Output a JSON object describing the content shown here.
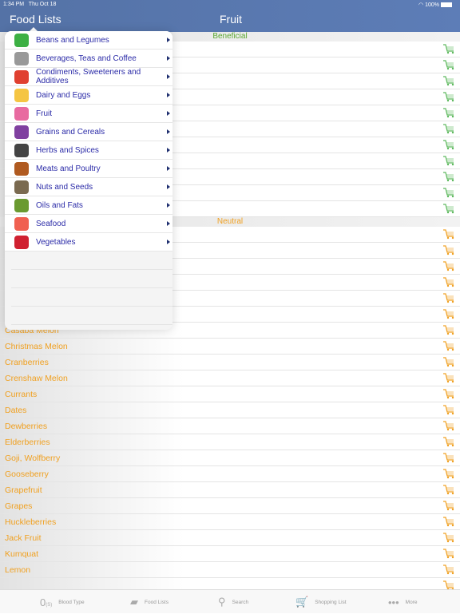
{
  "status": {
    "time": "1:34 PM",
    "date": "Thu Oct 18",
    "battery": "100%"
  },
  "nav": {
    "back": "Food Lists",
    "title": "Fruit"
  },
  "colors": {
    "beneficial": "#5aa830",
    "neutral": "#f0a020",
    "nav": "#5a7ab0",
    "menu_text": "#2c2ca8"
  },
  "sections": [
    {
      "label": "Beneficial",
      "color": "#5aa830",
      "items": [
        "",
        "",
        "",
        "",
        "",
        "",
        "",
        "",
        "",
        "",
        ""
      ]
    },
    {
      "label": "Neutral",
      "color": "#f0a020",
      "items": [
        "",
        "",
        "",
        "",
        "",
        "",
        "Casaba Melon",
        "Christmas Melon",
        "Cranberries",
        "Crenshaw Melon",
        "Currants",
        "Dates",
        "Dewberries",
        "Elderberries",
        "Goji, Wolfberry",
        "Gooseberry",
        "Grapefruit",
        "Grapes",
        "Huckleberries",
        "Jack Fruit",
        "Kumquat",
        "Lemon",
        ""
      ]
    }
  ],
  "menu": [
    {
      "label": "Beans and Legumes",
      "icon": "peas-icon",
      "color": "#3cb043"
    },
    {
      "label": "Beverages, Teas and Coffee",
      "icon": "drink-icon",
      "color": "#999999"
    },
    {
      "label": "Condiments, Sweeteners and Additives",
      "icon": "condiments-icon",
      "color": "#e04030"
    },
    {
      "label": "Dairy and Eggs",
      "icon": "cheese-icon",
      "color": "#f5c542"
    },
    {
      "label": "Fruit",
      "icon": "watermelon-icon",
      "color": "#e86aa0"
    },
    {
      "label": "Grains and Cereals",
      "icon": "grains-icon",
      "color": "#8040a0"
    },
    {
      "label": "Herbs and Spices",
      "icon": "shakers-icon",
      "color": "#444444"
    },
    {
      "label": "Meats and Poultry",
      "icon": "turkey-icon",
      "color": "#b05a20"
    },
    {
      "label": "Nuts and Seeds",
      "icon": "nuts-icon",
      "color": "#7a6a50"
    },
    {
      "label": "Oils and Fats",
      "icon": "oil-icon",
      "color": "#6a9a30"
    },
    {
      "label": "Seafood",
      "icon": "crab-icon",
      "color": "#f06050"
    },
    {
      "label": "Vegetables",
      "icon": "vegetables-icon",
      "color": "#d02030"
    }
  ],
  "tabbar": [
    {
      "label": "Blood Type",
      "icon": "blood-type-icon",
      "glyph": "0",
      "sub": "(S)"
    },
    {
      "label": "Food Lists",
      "icon": "folder-icon",
      "glyph": "▰"
    },
    {
      "label": "Search",
      "icon": "search-icon",
      "glyph": "⚲"
    },
    {
      "label": "Shopping List",
      "icon": "cart-icon",
      "glyph": "🛒"
    },
    {
      "label": "More",
      "icon": "more-icon",
      "glyph": "•••"
    }
  ]
}
